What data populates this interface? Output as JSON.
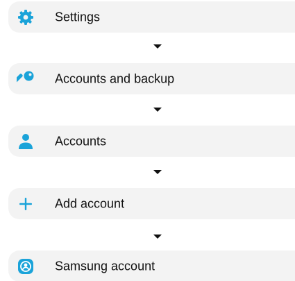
{
  "steps": [
    {
      "label": "Settings",
      "icon": "gear-icon"
    },
    {
      "label": "Accounts and backup",
      "icon": "key-icon"
    },
    {
      "label": "Accounts",
      "icon": "person-icon"
    },
    {
      "label": "Add account",
      "icon": "plus-icon"
    },
    {
      "label": "Samsung account",
      "icon": "samsung-account-icon"
    }
  ],
  "colors": {
    "accent": "#1aa3d9",
    "row_background": "#f3f3f3",
    "text": "#111111",
    "arrow": "#111111"
  }
}
